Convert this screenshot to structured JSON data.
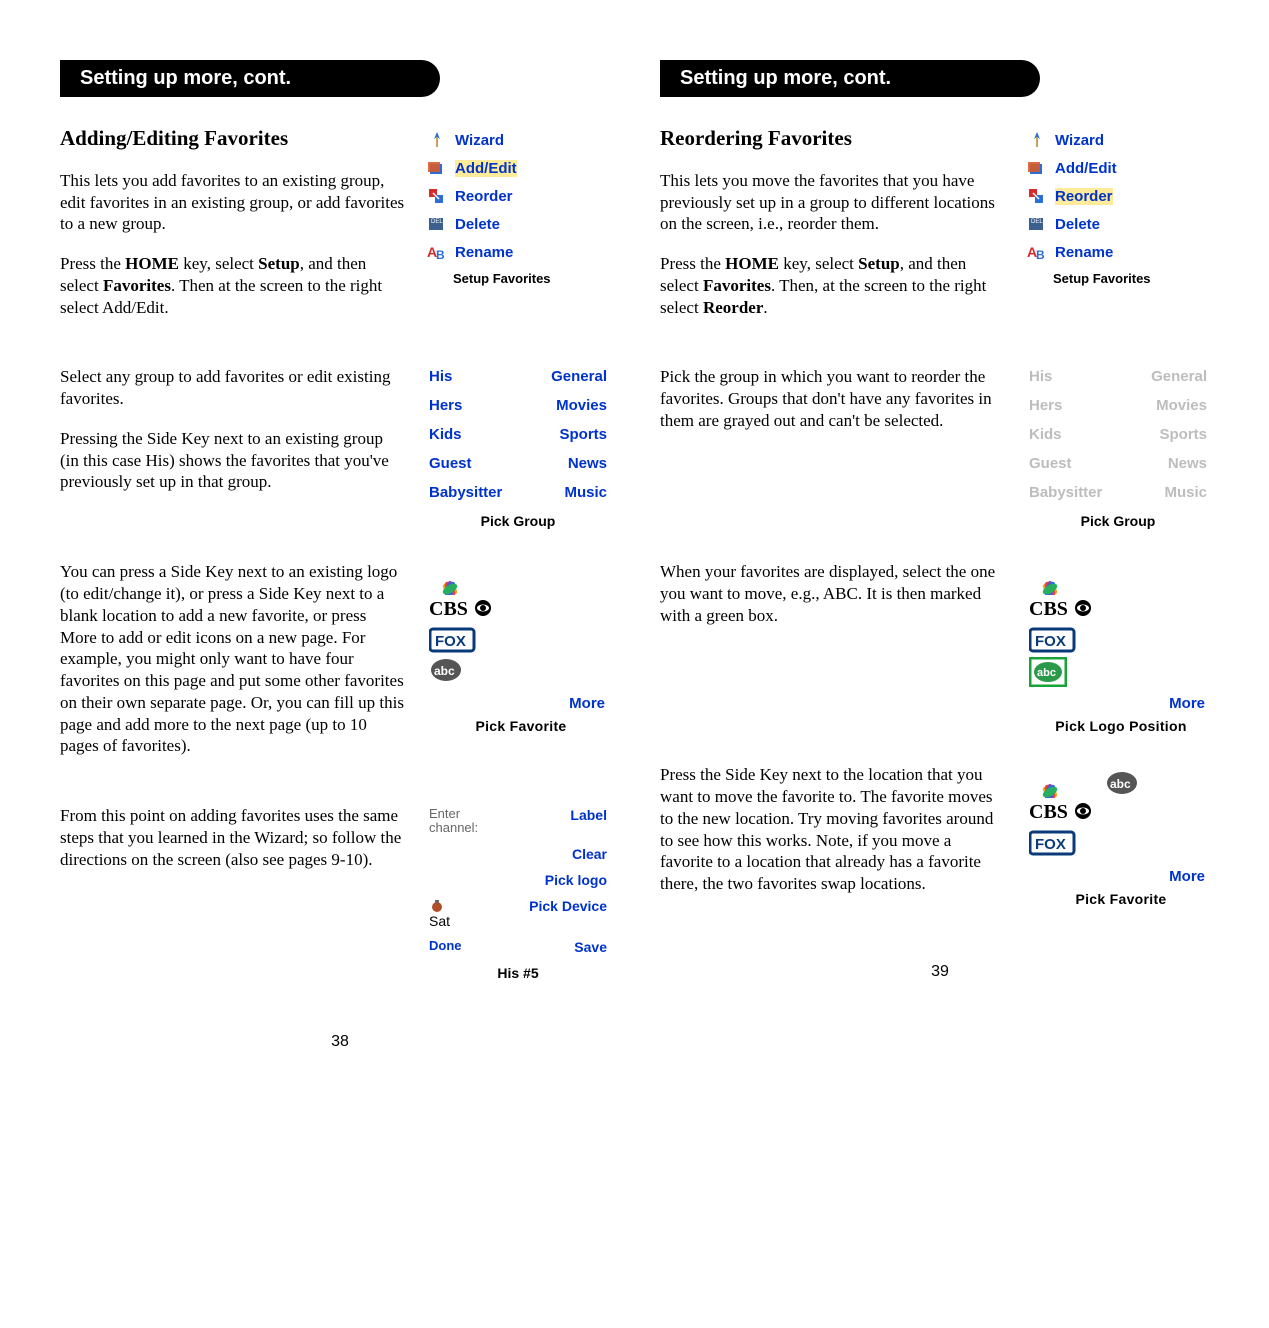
{
  "left": {
    "headerPill": "Setting up more, cont.",
    "sections": [
      {
        "heading": "Adding/Editing Favorites",
        "paras": [
          {
            "html": "This lets you add favorites to an existing group, edit favorites in an existing group, or add favorites to a new group."
          },
          {
            "html": "Press the <b>HOME</b> key, select <b>Setup</b>, and then select <b>Favorites</b>. Then at the screen to the right select Add/Edit."
          }
        ],
        "right": {
          "type": "menu",
          "items": [
            {
              "icon": "wiz",
              "label": "Wizard",
              "hl": false
            },
            {
              "icon": "ae",
              "label": "Add/Edit",
              "hl": true
            },
            {
              "icon": "reord",
              "label": "Reorder",
              "hl": false
            },
            {
              "icon": "del",
              "label": "Delete",
              "hl": false
            },
            {
              "icon": "ren",
              "label": "Rename",
              "hl": false
            }
          ],
          "footer": "Setup Favorites"
        }
      },
      {
        "paras": [
          {
            "html": "Select any group to add favorites or edit existing favorites."
          },
          {
            "html": "Pressing the Side Key next to an existing group (in this case His) shows the favorites that you've previously set up in that group."
          }
        ],
        "right": {
          "type": "twocol",
          "rows": [
            [
              "His",
              "General"
            ],
            [
              "Hers",
              "Movies"
            ],
            [
              "Kids",
              "Sports"
            ],
            [
              "Guest",
              "News"
            ],
            [
              "Babysitter",
              "Music"
            ]
          ],
          "grayRows": [],
          "footer": "Pick Group"
        }
      },
      {
        "paras": [
          {
            "html": "You can press a Side Key next to an existing logo (to edit/change it), or press a Side Key next to a blank location to add a new favorite, or press More to add or edit icons on a new page. For example, you might only want to have four favorites on this page and put some other favorites on their own separate page. Or, you can fill up this page and add more to the next page (up to 10 pages of favorites)."
          }
        ],
        "right": {
          "type": "logos",
          "logos": [
            "nbc",
            "cbs",
            "fox",
            "abc"
          ],
          "more": "More",
          "footer": "Pick Favorite"
        }
      },
      {
        "paras": [
          {
            "html": "From this point on adding favorites uses the same steps that you learned in the Wizard; so follow the directions on the screen (also see pages 9-10)."
          }
        ],
        "right": {
          "type": "enter",
          "rows": [
            {
              "left": "Enter<br>channel:",
              "right": "Label"
            },
            {
              "left": "",
              "right": "Clear"
            },
            {
              "left": "",
              "right": "Pick logo"
            },
            {
              "left": "Sat",
              "right": "Pick Device",
              "icon": "sat"
            },
            {
              "left": "Done",
              "right": "Save",
              "leftColor": "#0033cc",
              "leftBold": true
            }
          ],
          "footer": "His #5"
        }
      }
    ],
    "pageNum": "38"
  },
  "right": {
    "headerPill": "Setting up more, cont.",
    "sections": [
      {
        "heading": "Reordering Favorites",
        "paras": [
          {
            "html": "This lets you move the favorites that you have previously set up in a group to different locations on the screen, i.e., reorder them."
          },
          {
            "html": "Press the <b>HOME</b> key, select <b>Setup</b>, and then select <b>Favorites</b>. Then, at the screen to the right select <b>Reorder</b>."
          }
        ],
        "right": {
          "type": "menu",
          "items": [
            {
              "icon": "wiz",
              "label": "Wizard",
              "hl": false
            },
            {
              "icon": "ae",
              "label": "Add/Edit",
              "hl": false
            },
            {
              "icon": "reord",
              "label": "Reorder",
              "hl": true
            },
            {
              "icon": "del",
              "label": "Delete",
              "hl": false
            },
            {
              "icon": "ren",
              "label": "Rename",
              "hl": false
            }
          ],
          "footer": "Setup Favorites"
        }
      },
      {
        "paras": [
          {
            "html": "Pick the group in which you want to reorder the favorites. Groups that don't have any favorites in them are grayed out and can't be selected."
          }
        ],
        "right": {
          "type": "twocol",
          "rows": [
            [
              "His",
              "General"
            ],
            [
              "Hers",
              "Movies"
            ],
            [
              "Kids",
              "Sports"
            ],
            [
              "Guest",
              "News"
            ],
            [
              "Babysitter",
              "Music"
            ]
          ],
          "grayRows": [
            1,
            2,
            3,
            4
          ],
          "grayCols1": [
            0
          ],
          "footer": "Pick Group"
        }
      },
      {
        "paras": [
          {
            "html": "When your favorites are displayed, select the one you want to move, e.g., ABC. It is then marked with a green box."
          }
        ],
        "right": {
          "type": "logos",
          "logos": [
            "nbc",
            "cbs",
            "fox",
            "abc-green"
          ],
          "more": "More",
          "footer": "Pick Logo Position"
        }
      },
      {
        "paras": [
          {
            "html": "Press the Side Key next to the location that you want to move the favorite to. The favorite moves to the new location. Try moving favorites around to see how this works. Note, if you move a favorite to a location that already has a favorite there, the two favorites swap locations."
          }
        ],
        "right": {
          "type": "poslogos",
          "col1": [
            "nbc",
            "cbs",
            "fox"
          ],
          "col2top": "abc",
          "more": "More",
          "footer": "Pick Favorite"
        }
      }
    ],
    "pageNum": "39"
  }
}
